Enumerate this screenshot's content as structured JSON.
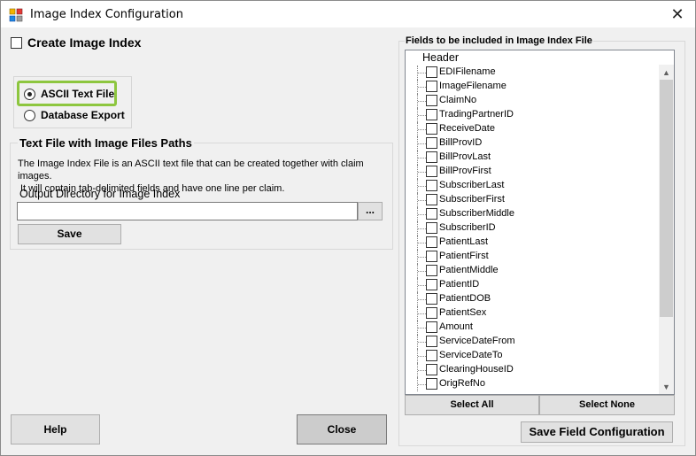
{
  "window": {
    "title": "Image Index Configuration"
  },
  "create_index": {
    "label": "Create Image Index",
    "checked": false
  },
  "format": {
    "options": [
      {
        "label": "ASCII Text File",
        "checked": true
      },
      {
        "label": "Database Export",
        "checked": false
      }
    ]
  },
  "textfile": {
    "group_title": "Text File with Image Files Paths",
    "desc_line1": "The Image Index File is an ASCII text file that can be created together with claim images.",
    "desc_line2": "It will contain tab-delimited fields and have one line per claim.",
    "output_label": "Output Directory for Image Index",
    "output_value": "",
    "browse_label": "...",
    "save_label": "Save"
  },
  "footer": {
    "help_label": "Help",
    "close_label": "Close"
  },
  "fields": {
    "group_title": "Fields to be included in Image Index File",
    "header_label": "Header",
    "items": [
      "EDIFilename",
      "ImageFilename",
      "ClaimNo",
      "TradingPartnerID",
      "ReceiveDate",
      "BillProvID",
      "BillProvLast",
      "BillProvFirst",
      "SubscriberLast",
      "SubscriberFirst",
      "SubscriberMiddle",
      "SubscriberID",
      "PatientLast",
      "PatientFirst",
      "PatientMiddle",
      "PatientID",
      "PatientDOB",
      "PatientSex",
      "Amount",
      "ServiceDateFrom",
      "ServiceDateTo",
      "ClearingHouseID",
      "OrigRefNo"
    ],
    "select_all_label": "Select All",
    "select_none_label": "Select None",
    "save_config_label": "Save Field Configuration"
  },
  "colors": {
    "highlight": "#8dc63f"
  }
}
